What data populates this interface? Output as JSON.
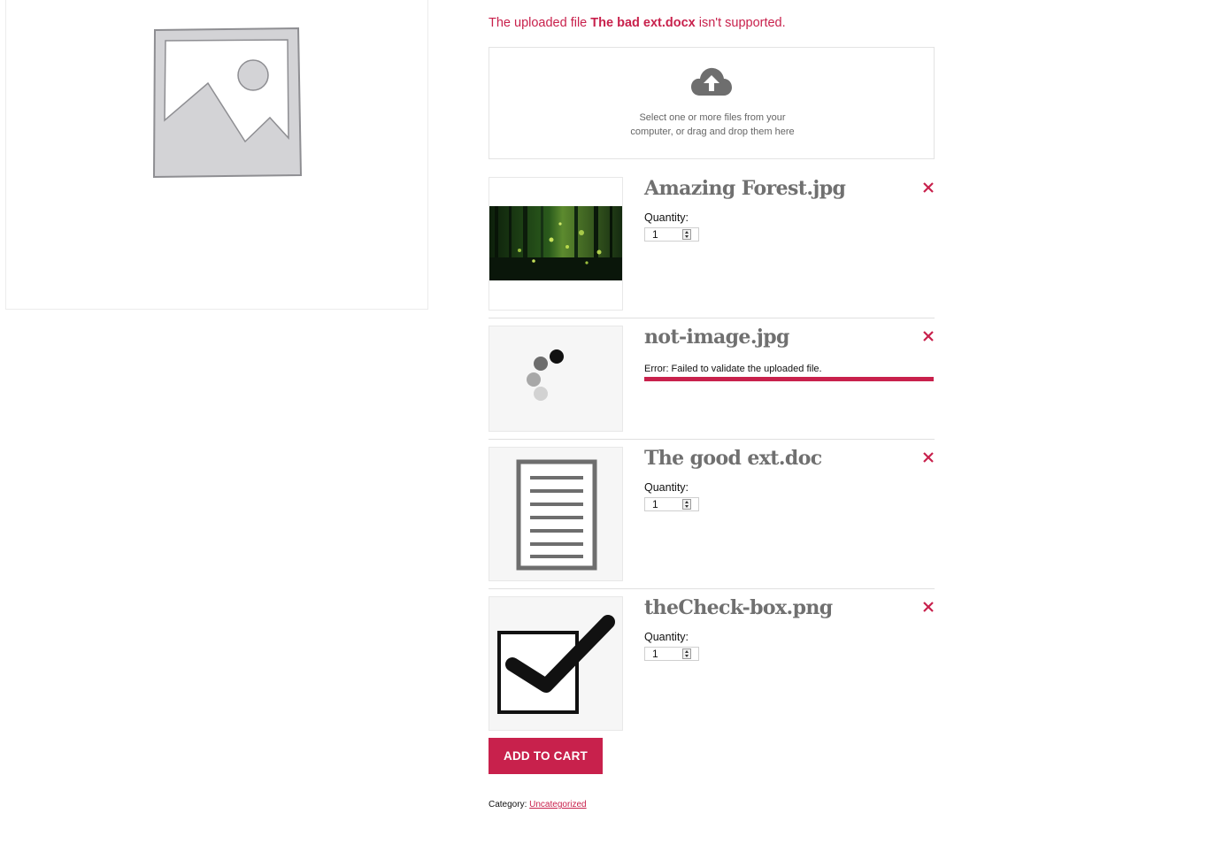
{
  "notice": {
    "prefix": "The uploaded file ",
    "filename": "The bad ext.docx",
    "suffix": " isn't supported."
  },
  "dropzone": {
    "text_line1": "Select one or more files from your",
    "text_line2": "computer, or drag and drop them here",
    "icon": "cloud-upload-icon"
  },
  "files": [
    {
      "name": "Amazing Forest.jpg",
      "quantity_label": "Quantity:",
      "quantity": "1",
      "thumbnail": "forest-photo"
    },
    {
      "name": "not-image.jpg",
      "error": "Error: Failed to validate the uploaded file.",
      "progress": 1.0,
      "thumbnail": "loading-spinner-icon"
    },
    {
      "name": "The good ext.doc",
      "quantity_label": "Quantity:",
      "quantity": "1",
      "thumbnail": "document-icon"
    },
    {
      "name": "theCheck-box.png",
      "quantity_label": "Quantity:",
      "quantity": "1",
      "thumbnail": "checkbox-icon"
    }
  ],
  "add_to_cart_label": "ADD TO CART",
  "meta": {
    "category_label": "Category: ",
    "category_link": "Uncategorized"
  },
  "colors": {
    "accent": "#c8214c",
    "title_gray": "#707070",
    "placeholder_gray": "#d3d3d6"
  }
}
